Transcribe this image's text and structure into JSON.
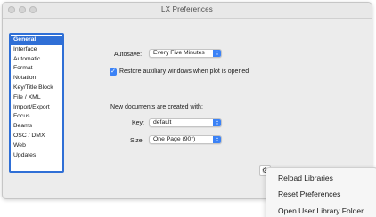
{
  "window": {
    "title": "LX Preferences"
  },
  "sidebar": {
    "items": [
      {
        "label": "General",
        "selected": true
      },
      {
        "label": "Interface"
      },
      {
        "label": "Automatic"
      },
      {
        "label": "Format"
      },
      {
        "label": "Notation"
      },
      {
        "label": "Key/Title Block"
      },
      {
        "label": "File / XML"
      },
      {
        "label": "Import/Export"
      },
      {
        "label": "Focus"
      },
      {
        "label": "Beams"
      },
      {
        "label": "OSC / DMX"
      },
      {
        "label": "Web"
      },
      {
        "label": "Updates"
      }
    ]
  },
  "general": {
    "autosave_label": "Autosave:",
    "autosave_value": "Every Five Minutes",
    "restore_label": "Restore auxiliary windows when plot is opened",
    "restore_checked": true,
    "new_docs_label": "New documents are created with:",
    "key_label": "Key:",
    "key_value": "default",
    "size_label": "Size:",
    "size_value": "One Page (90°)"
  },
  "gear_menu": {
    "items": [
      "Reload Libraries",
      "Reset Preferences",
      "Open User Library Folder"
    ]
  },
  "colors": {
    "accent": "#2f6fd6",
    "control_accent": "#3b82f6"
  }
}
